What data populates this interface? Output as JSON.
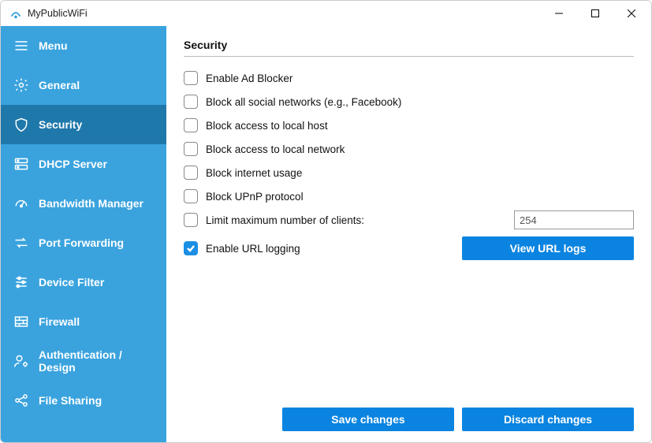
{
  "app": {
    "title": "MyPublicWiFi"
  },
  "sidebar": {
    "items": [
      {
        "label": "Menu"
      },
      {
        "label": "General"
      },
      {
        "label": "Security"
      },
      {
        "label": "DHCP Server"
      },
      {
        "label": "Bandwidth Manager"
      },
      {
        "label": "Port Forwarding"
      },
      {
        "label": "Device Filter"
      },
      {
        "label": "Firewall"
      },
      {
        "label": "Authentication / Design"
      },
      {
        "label": "File Sharing"
      }
    ],
    "active_index": 2
  },
  "page": {
    "title": "Security",
    "options": {
      "enable_ad_blocker": "Enable Ad Blocker",
      "block_social": "Block all social networks (e.g., Facebook)",
      "block_localhost": "Block access to local host",
      "block_localnet": "Block access to local network",
      "block_internet": "Block internet usage",
      "block_upnp": "Block UPnP protocol",
      "limit_clients": "Limit maximum number of clients:",
      "enable_url_logging": "Enable URL logging"
    },
    "max_clients_value": "254",
    "view_url_logs": "View URL logs",
    "save": "Save changes",
    "discard": "Discard changes"
  }
}
